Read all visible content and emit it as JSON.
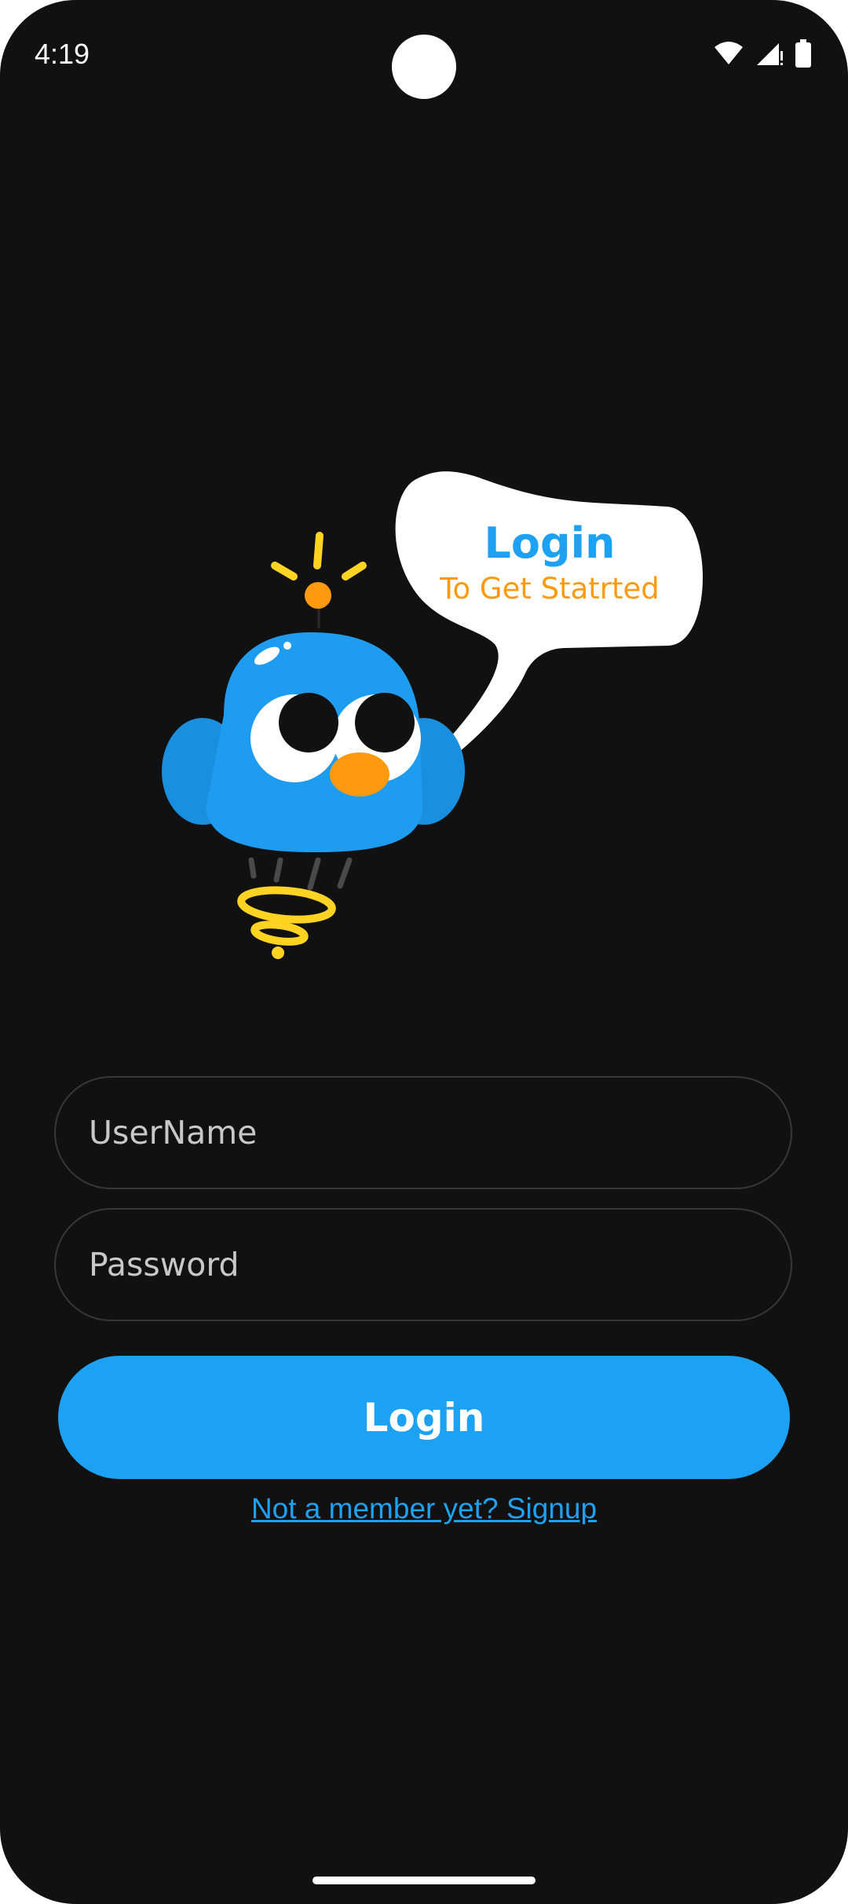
{
  "status_bar": {
    "time": "4:19",
    "icons": [
      "wifi-icon",
      "cell-signal-icon",
      "battery-icon"
    ]
  },
  "mascot": {
    "bubble_title": "Login",
    "bubble_subtitle": "To Get Statrted",
    "colors": {
      "body": "#1e9cf0",
      "ear": "#1a8fe0",
      "beak": "#ff9a10",
      "spring": "#ffd321",
      "antenna_ball": "#ff9a10"
    }
  },
  "form": {
    "username_placeholder": "UserName",
    "password_placeholder": "Password",
    "login_label": "Login",
    "signup_text": "Not a member yet? Signup"
  },
  "colors": {
    "background": "#111111",
    "accent": "#1da1f2",
    "field_border": "#333a37"
  }
}
